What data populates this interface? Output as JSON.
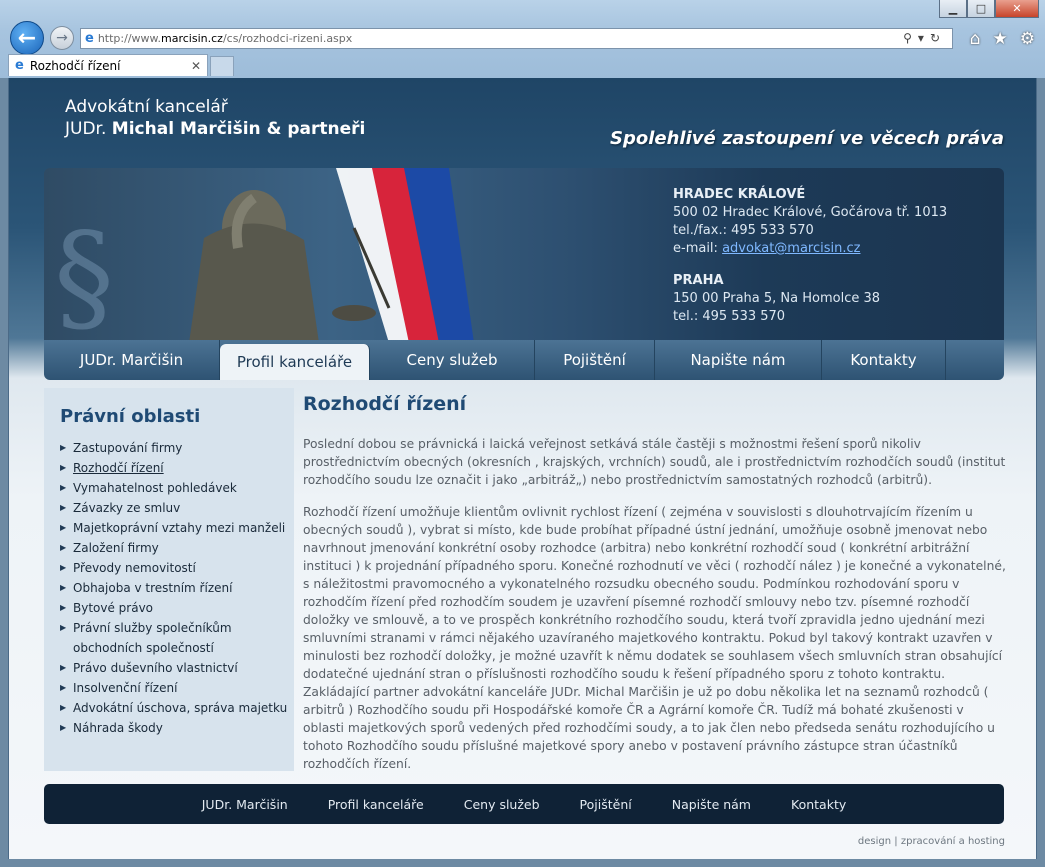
{
  "browser": {
    "url_prefix": "http://www.",
    "url_host": "marcisin.cz",
    "url_path": "/cs/rozhodci-rizeni.aspx",
    "tab_title": "Rozhodčí řízení",
    "controls": {
      "minimize": "▁",
      "maximize": "□",
      "close": "✕"
    },
    "icons": [
      "home-icon",
      "favorites-star-icon",
      "settings-gear-icon"
    ]
  },
  "header": {
    "firm_line1": "Advokátní kancelář",
    "firm_prefix": "JUDr.",
    "firm_name": "Michal Marčišin & partneři",
    "slogan": "Spolehlivé zastoupení ve věcech práva"
  },
  "contacts": {
    "hradec": {
      "city": "HRADEC KRÁLOVÉ",
      "address": "500 02 Hradec Králové, Gočárova tř. 1013",
      "phone": "tel./fax.: 495 533 570",
      "email_label": "e-mail:",
      "email": "advokat@marcisin.cz"
    },
    "praha": {
      "city": "PRAHA",
      "address": "150 00 Praha 5, Na Homolce 38",
      "phone": "tel.: 495 533 570"
    }
  },
  "nav": {
    "items": [
      "JUDr. Marčišin",
      "Profil kanceláře",
      "Ceny služeb",
      "Pojištění",
      "Napište nám",
      "Kontakty"
    ],
    "active_index": 1
  },
  "sidebar": {
    "title": "Právní oblasti",
    "items": [
      "Zastupování firmy",
      "Rozhodčí řízení",
      "Vymahatelnost pohledávek",
      "Závazky ze smluv",
      "Majetkoprávní vztahy mezi manželi",
      "Založení firmy",
      "Převody nemovitostí",
      "Obhajoba v trestním řízení",
      "Bytové právo",
      "Právní služby společníkům obchodních společností",
      "Právo duševního vlastnictví",
      "Insolvenční řízení",
      "Advokátní úschova, správa majetku",
      "Náhrada škody"
    ],
    "current_index": 1
  },
  "content": {
    "title": "Rozhodčí řízení",
    "paragraph1": "Poslední dobou se právnická i laická veřejnost setkává stále častěji s možnostmi řešení sporů nikoliv prostřednictvím obecných (okresních , krajských, vrchních) soudů, ale i prostřednictvím rozhodčích soudů (institut rozhodčího soudu lze označit i jako „arbitráž„) nebo prostřednictvím samostatných rozhodců (arbitrů).",
    "paragraph2": "Rozhodčí řízení umožňuje klientům ovlivnit rychlost řízení ( zejména v souvislosti s dlouhotrvajícím řízením u obecných soudů ), vybrat si místo, kde bude probíhat případné ústní jednání, umožňuje osobně jmenovat nebo navrhnout jmenování konkrétní osoby rozhodce (arbitra) nebo konkrétní rozhodčí soud ( konkrétní arbitrážní instituci ) k projednání případného sporu. Konečné rozhodnutí ve věci ( rozhodčí nález ) je konečné a vykonatelné, s náležitostmi pravomocného a vykonatelného rozsudku obecného soudu. Podmínkou rozhodování sporu v rozhodčím řízení před rozhodčím soudem je uzavření písemné rozhodčí smlouvy nebo tzv. písemné rozhodčí doložky ve smlouvě, a to ve prospěch konkrétního rozhodčího soudu, která tvoří zpravidla jedno ujednání mezi smluvními stranami v rámci nějakého uzavíraného majetkového kontraktu. Pokud byl takový kontrakt uzavřen v minulosti bez rozhodčí doložky, je možné uzavřít k němu dodatek se souhlasem všech smluvních stran obsahující dodatečné ujednání stran o příslušnosti rozhodčího soudu k řešení případného sporu z tohoto kontraktu. Zakládající partner advokátní kanceláře JUDr. Michal Marčišin je už po dobu několika let na seznamů rozhodců ( arbitrů ) Rozhodčího soudu při Hospodářské komoře ČR a Agrární komoře ČR. Tudíž má bohaté zkušenosti v oblasti majetkových sporů vedených před rozhodčími soudy, a to jak člen nebo předseda senátu rozhodujícího u tohoto Rozhodčího soudu příslušné majetkové spory anebo v postavení právního zástupce stran účastníků rozhodčích řízení."
  },
  "footer": {
    "nav": [
      "JUDr. Marčišin",
      "Profil kanceláře",
      "Ceny služeb",
      "Pojištění",
      "Napište nám",
      "Kontakty"
    ],
    "credit_design": "design",
    "credit_sep": "|",
    "credit_rest": "zpracování a hosting"
  }
}
